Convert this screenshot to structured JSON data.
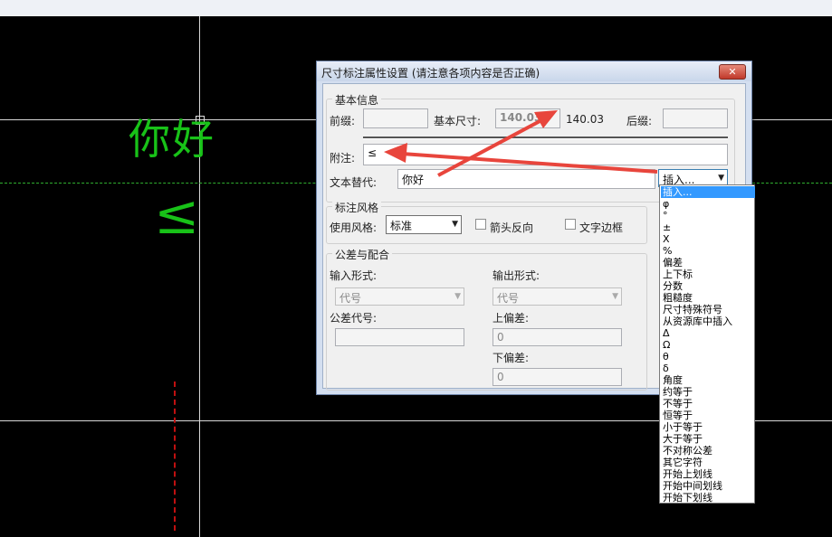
{
  "canvas": {
    "text_nihao": "你好",
    "text_leq": "≤"
  },
  "dialog": {
    "title": "尺寸标注属性设置 (请注意各项内容是否正确)",
    "close_label": "✕",
    "basic": {
      "title": "基本信息",
      "prefix_label": "前缀:",
      "prefix_value": "",
      "base_size_label": "基本尺寸:",
      "base_size_value": "140.03",
      "base_size_readonly": "140.03",
      "suffix_label": "后缀:",
      "suffix_value": "",
      "note_label": "附注:",
      "note_value": "≤",
      "text_replace_label": "文本替代:",
      "text_replace_value": "你好",
      "insert_combo": "插入..."
    },
    "style": {
      "title": "标注风格",
      "use_style_label": "使用风格:",
      "use_style_value": "标准",
      "arrow_reverse_label": "箭头反向",
      "text_border_label": "文字边框"
    },
    "tolerance": {
      "title": "公差与配合",
      "input_form_label": "输入形式:",
      "input_form_value": "代号",
      "output_form_label": "输出形式:",
      "output_form_value": "代号",
      "tol_code_label": "公差代号:",
      "tol_code_value": "",
      "upper_dev_label": "上偏差:",
      "upper_dev_value": "0",
      "lower_dev_label": "下偏差:",
      "lower_dev_value": "0"
    }
  },
  "dropdown": {
    "items": [
      "插入...",
      "φ",
      "°",
      "±",
      "X",
      "%",
      "偏差",
      "上下标",
      "分数",
      "粗糙度",
      "尺寸特殊符号",
      "从资源库中插入",
      "Δ",
      "Ω",
      "θ",
      "δ",
      "角度",
      "约等于",
      "不等于",
      "恒等于",
      "小于等于",
      "大于等于",
      "不对称公差",
      "其它字符",
      "开始上划线",
      "开始中间划线",
      "开始下划线"
    ],
    "selected": "插入..."
  },
  "colors": {
    "cad_background": "#000000",
    "cad_text": "#18c218",
    "annotation_arrow": "#e8453c",
    "selection": "#3399ff"
  }
}
